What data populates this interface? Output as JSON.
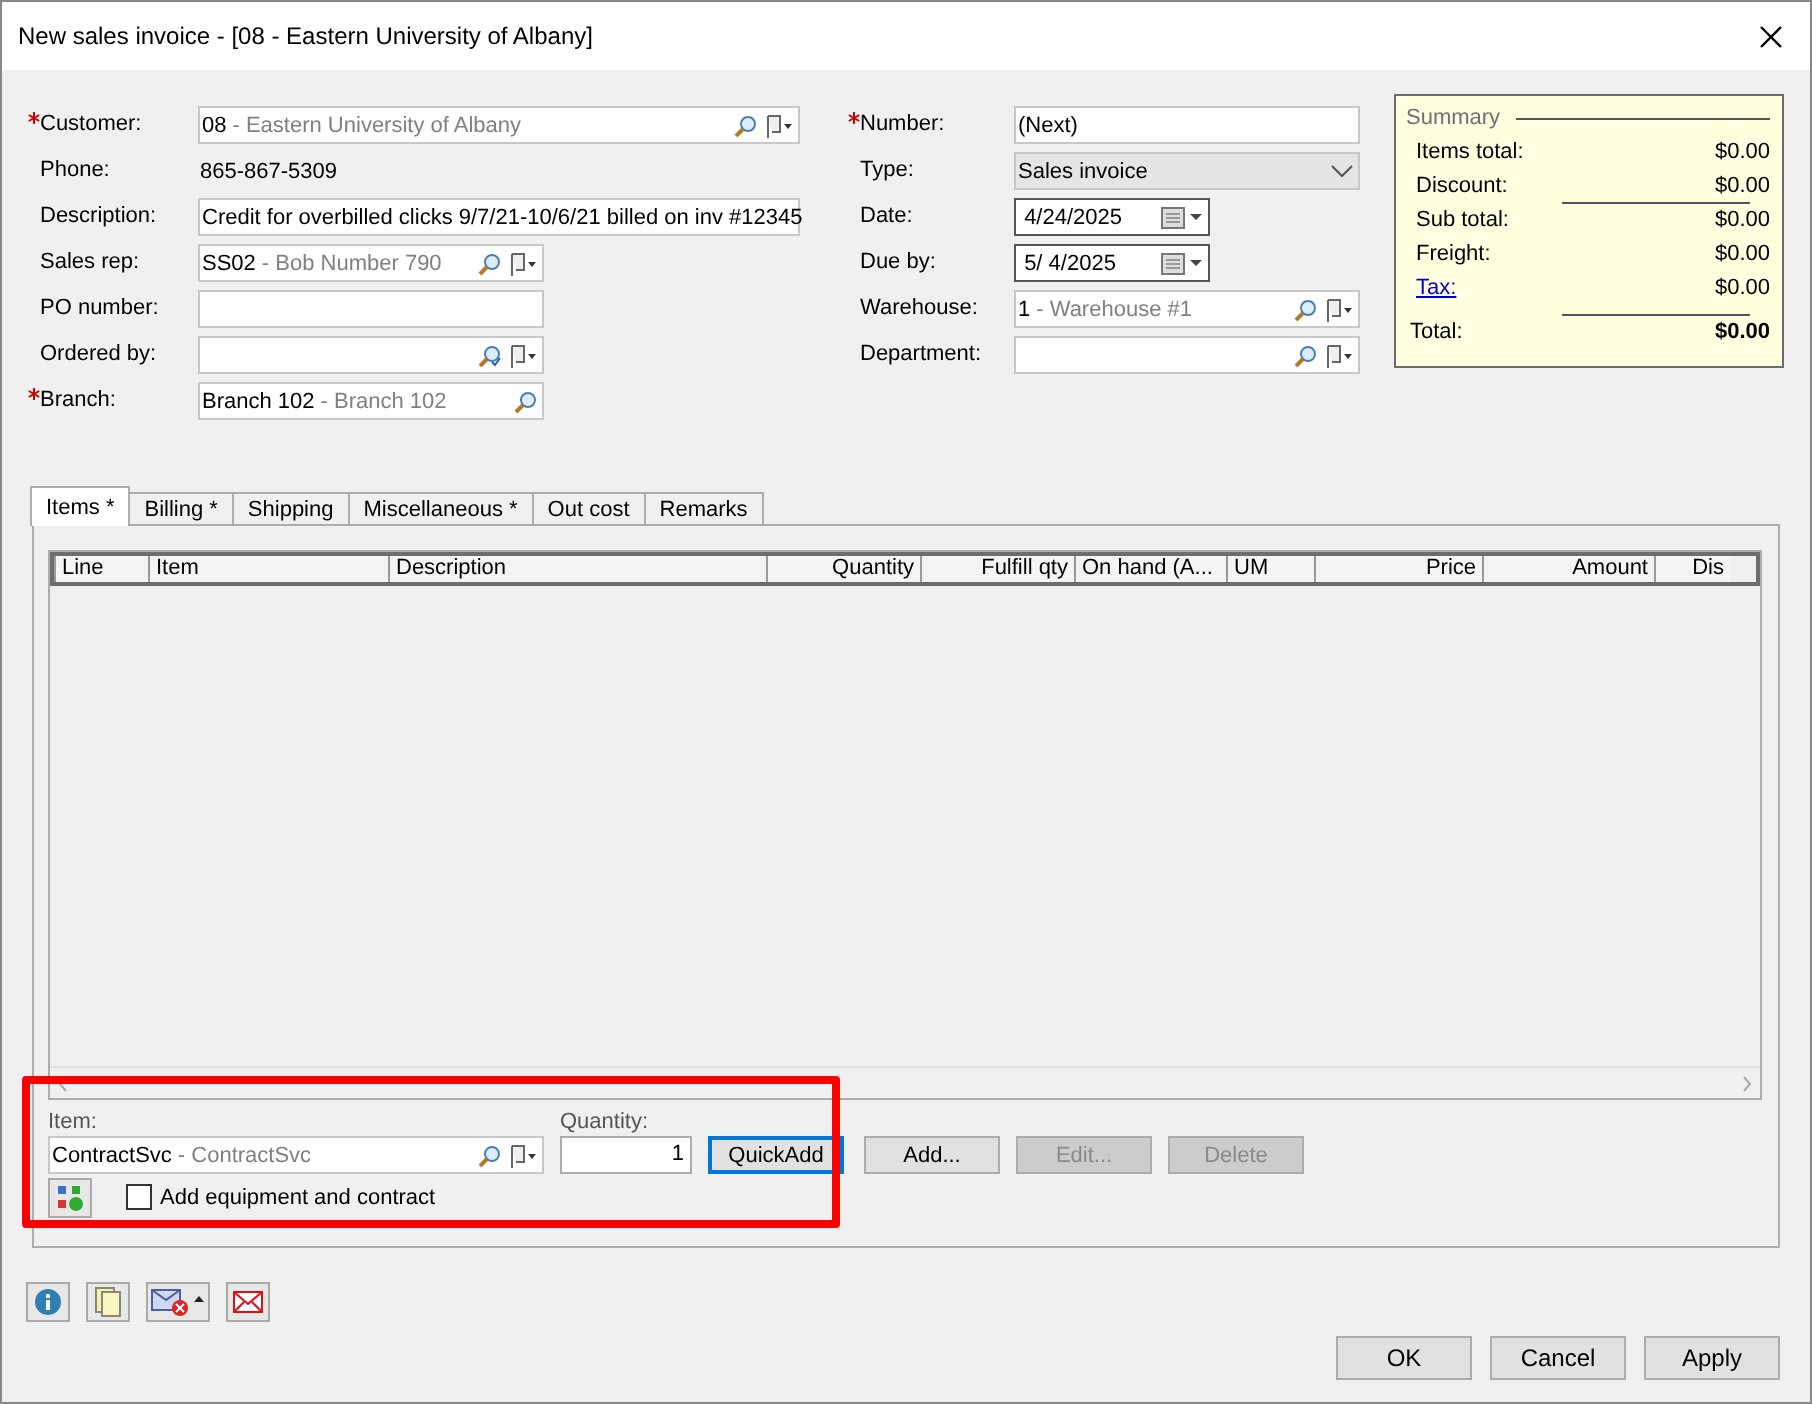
{
  "window": {
    "title": "New sales invoice - [08 - Eastern University of Albany]"
  },
  "left_fields": [
    {
      "label": "Customer:",
      "required": true,
      "kind": "lookup",
      "code": "08",
      "name": "- Eastern University of Albany",
      "wide": true,
      "menu": true
    },
    {
      "label": "Phone:",
      "required": false,
      "kind": "static",
      "value": "865-867-5309"
    },
    {
      "label": "Description:",
      "required": false,
      "kind": "text",
      "value": "Credit for overbilled clicks 9/7/21-10/6/21 billed on inv #12345",
      "wide": true
    },
    {
      "label": "Sales rep:",
      "required": false,
      "kind": "lookup",
      "code": "SS02",
      "name": "- Bob Number 790",
      "wide": false,
      "menu": true
    },
    {
      "label": "PO number:",
      "required": false,
      "kind": "text",
      "wide": false
    },
    {
      "label": "Ordered by:",
      "required": false,
      "kind": "lookup",
      "wide": false,
      "menu": true
    },
    {
      "label": "Branch:",
      "required": true,
      "kind": "lookup",
      "code": "Branch 102",
      "name": "- Branch 102",
      "wide": false,
      "menu": false
    }
  ],
  "right_fields": [
    {
      "label": "Number:",
      "required": true,
      "kind": "text",
      "value": "(Next)"
    },
    {
      "label": "Type:",
      "required": false,
      "kind": "combo",
      "value": "Sales invoice"
    },
    {
      "label": "Date:",
      "required": false,
      "kind": "date",
      "value": "4/24/2025"
    },
    {
      "label": "Due by:",
      "required": false,
      "kind": "date",
      "value": "5/  4/2025"
    },
    {
      "label": "Warehouse:",
      "required": false,
      "kind": "lookup",
      "code": "1",
      "name": "- Warehouse #1",
      "menu": true
    },
    {
      "label": "Department:",
      "required": false,
      "kind": "lookup",
      "menu": true
    }
  ],
  "summary": {
    "title": "Summary",
    "rows": [
      {
        "label": "Items total:",
        "value": "$0.00",
        "kind": "plain",
        "rule_above": false
      },
      {
        "label": "Discount:",
        "value": "$0.00",
        "kind": "plain",
        "rule_above": false
      },
      {
        "label": "Sub total:",
        "value": "$0.00",
        "kind": "plain",
        "rule_above": true
      },
      {
        "label": "Freight:",
        "value": "$0.00",
        "kind": "plain",
        "rule_above": false
      },
      {
        "label": "Tax:",
        "value": "$0.00",
        "kind": "link",
        "rule_above": false
      },
      {
        "label": "Total:",
        "value": "$0.00",
        "kind": "total",
        "rule_above": true
      }
    ]
  },
  "tabs": [
    {
      "label": "Items *",
      "selected": true
    },
    {
      "label": "Billing  *",
      "selected": false
    },
    {
      "label": "Shipping",
      "selected": false
    },
    {
      "label": "Miscellaneous *",
      "selected": false
    },
    {
      "label": "Out cost",
      "selected": false
    },
    {
      "label": "Remarks",
      "selected": false
    }
  ],
  "table": {
    "columns": [
      "Line",
      "Item",
      "Description",
      "Quantity",
      "Fulfill qty",
      "On hand (A...",
      "UM",
      "Price",
      "Amount",
      "Dis"
    ]
  },
  "item_entry": {
    "item_label": "Item:",
    "item_code": "ContractSvc",
    "item_name": "- ContractSvc",
    "quantity_label": "Quantity:",
    "quantity": "1",
    "buttons": [
      {
        "label": "QuickAdd",
        "disabled": false,
        "default": true
      },
      {
        "label": "Add...",
        "disabled": false,
        "default": false
      },
      {
        "label": "Edit...",
        "disabled": true,
        "default": false
      },
      {
        "label": "Delete",
        "disabled": true,
        "default": false
      }
    ],
    "checkbox": {
      "label": "Add equipment and contract",
      "checked": false
    },
    "highlighted": true
  },
  "dialog_buttons": [
    "OK",
    "Cancel",
    "Apply"
  ]
}
